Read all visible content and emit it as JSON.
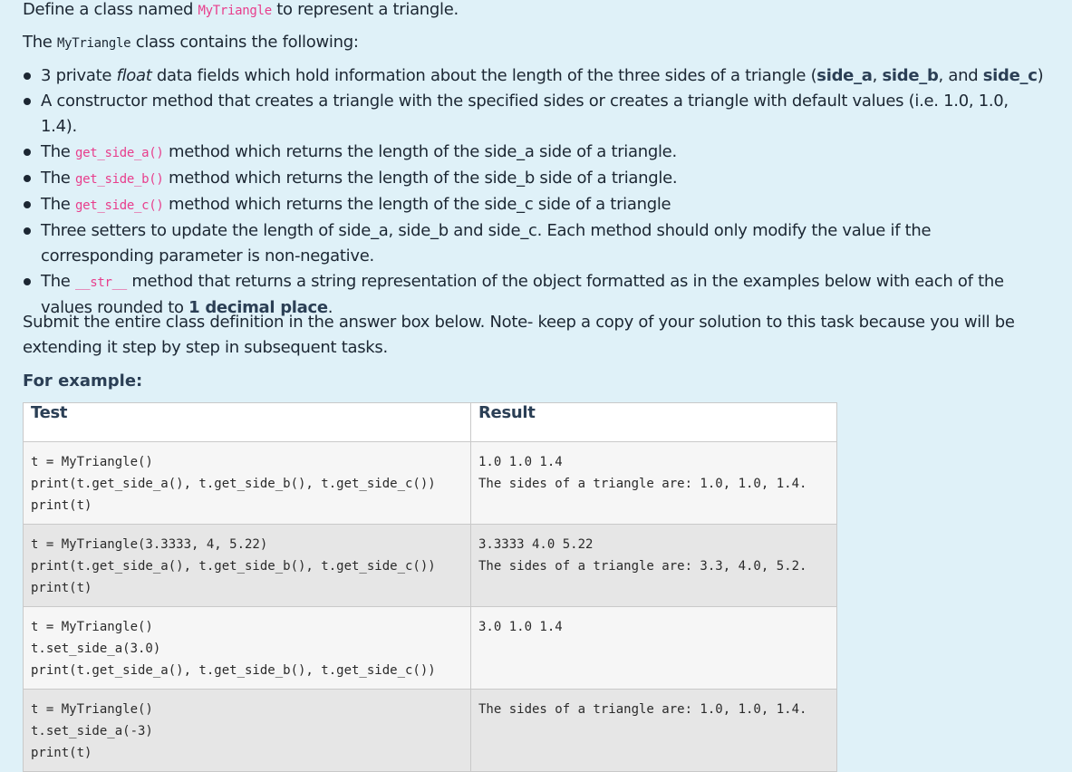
{
  "intro": {
    "before": "Define a class named ",
    "class_name": "MyTriangle",
    "after": " to represent a triangle."
  },
  "contains": {
    "before": "The ",
    "class_name": "MyTriangle",
    "after": " class contains the following:"
  },
  "bullets": {
    "b1": {
      "p1": "3 private ",
      "italic": "float",
      "p2": " data fields which hold information about the length of the three sides of a triangle (",
      "s1": "side_a",
      "sep1": ", ",
      "s2": "side_b",
      "sep2": ", and ",
      "s3": "side_c",
      "p3": ")"
    },
    "b2": "A constructor method that creates a triangle with the specified sides or creates a triangle with default values (i.e. 1.0, 1.0, 1.4).",
    "b3": {
      "before": "The ",
      "code": "get_side_a()",
      "after": " method which returns the length of the side_a side of a triangle."
    },
    "b4": {
      "before": "The ",
      "code": "get_side_b()",
      "after": " method which returns the length of the side_b side of a triangle."
    },
    "b5": {
      "before": "The ",
      "code": "get_side_c()",
      "after": " method which returns the length of the side_c side of a triangle"
    },
    "b6": "Three setters to update the length of side_a, side_b and side_c. Each method should only modify the value if the corresponding parameter is non-negative.",
    "b7": {
      "before": "The ",
      "code": "__str__",
      "mid": " method that returns a string representation of the object formatted as in the examples below with each of the values rounded to ",
      "bold": "1 decimal place",
      "after": "."
    }
  },
  "submit_text": "Submit the entire class definition in the answer box below. Note- keep a copy of your solution to this task because you will be extending it step by step in subsequent tasks.",
  "for_example": "For example:",
  "table": {
    "headers": {
      "test": "Test",
      "result": "Result"
    },
    "rows": [
      {
        "test": "t = MyTriangle()\nprint(t.get_side_a(), t.get_side_b(), t.get_side_c())\nprint(t)",
        "result": "1.0 1.0 1.4\nThe sides of a triangle are: 1.0, 1.0, 1.4."
      },
      {
        "test": "t = MyTriangle(3.3333, 4, 5.22)\nprint(t.get_side_a(), t.get_side_b(), t.get_side_c())\nprint(t)",
        "result": "3.3333 4.0 5.22\nThe sides of a triangle are: 3.3, 4.0, 5.2."
      },
      {
        "test": "t = MyTriangle()\nt.set_side_a(3.0)\nprint(t.get_side_a(), t.get_side_b(), t.get_side_c())",
        "result": "3.0 1.0 1.4"
      },
      {
        "test": "t = MyTriangle()\nt.set_side_a(-3)\nprint(t)",
        "result": "The sides of a triangle are: 1.0, 1.0, 1.4."
      }
    ]
  }
}
